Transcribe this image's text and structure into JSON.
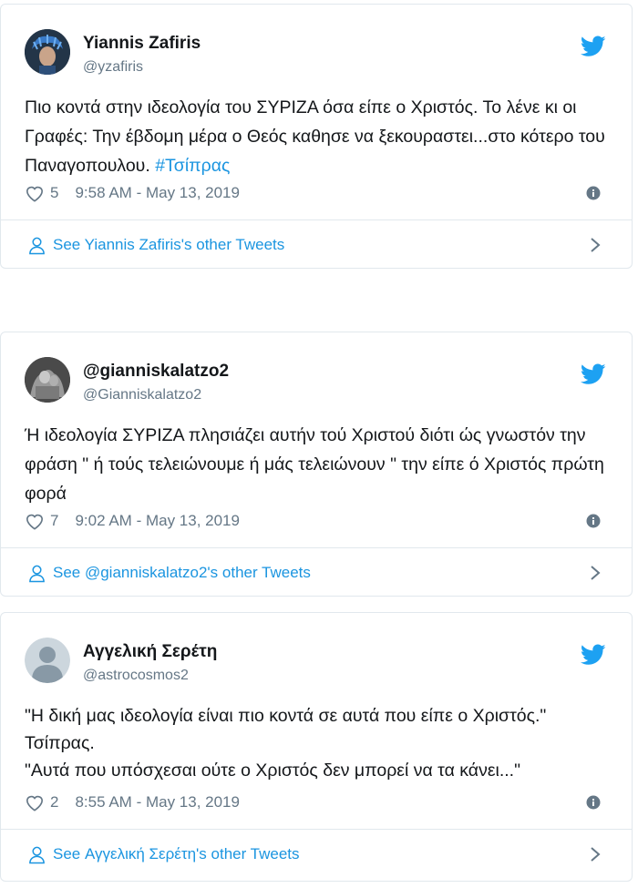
{
  "tweets": [
    {
      "name": "Yiannis Zafiris",
      "handle": "@yzafiris",
      "text": "Πιο κοντά στην ιδεολογία του ΣΥΡΙΖΑ όσα είπε ο Χριστός. Το λένε κι οι Γραφές: Την έβδομη μέρα ο Θεός καθησε να ξεκουραστει...στο κότερο του Παναγοπουλου. ",
      "hashtag": "#Τσίπρας",
      "likes": "5",
      "timestamp": "9:58 AM - May 13, 2019",
      "footer": "See Yiannis Zafiris's other Tweets"
    },
    {
      "name": "@gianniskalatzo2",
      "handle": "@Gianniskalatzo2",
      "text": "Ή ιδεολογία ΣΥΡΙΖΑ πλησιάζει αυτήν τού Χριστού διότι ώς γνωστόν την φράση \" ή τούς τελειώνουμε ή μάς τελειώνουν \" την είπε ό Χριστός πρώτη φορά",
      "hashtag": "",
      "likes": "7",
      "timestamp": "9:02 AM - May 13, 2019",
      "footer": "See @gianniskalatzo2's other Tweets"
    },
    {
      "name": "Αγγελική Σερέτη",
      "handle": "@astrocosmos2",
      "text_lines": [
        "\"Η δική μας ιδεολογία είναι πιο κοντά σε αυτά που είπε ο Χριστός.\"",
        "Τσίπρας.",
        "\"Αυτά που υπόσχεσαι ούτε ο Χριστός δεν μπορεί να τα κάνει...\""
      ],
      "likes": "2",
      "timestamp": "8:55 AM - May 13, 2019",
      "footer": "See Αγγελική Σερέτη's other Tweets"
    }
  ],
  "colors": {
    "link": "#1b95e0",
    "text": "#14171a",
    "muted": "#657786",
    "border": "#e1e8ed",
    "twitter_blue": "#1da1f2"
  },
  "icons": [
    "twitter-bird-icon",
    "heart-icon",
    "info-icon",
    "person-icon",
    "chevron-right-icon"
  ]
}
